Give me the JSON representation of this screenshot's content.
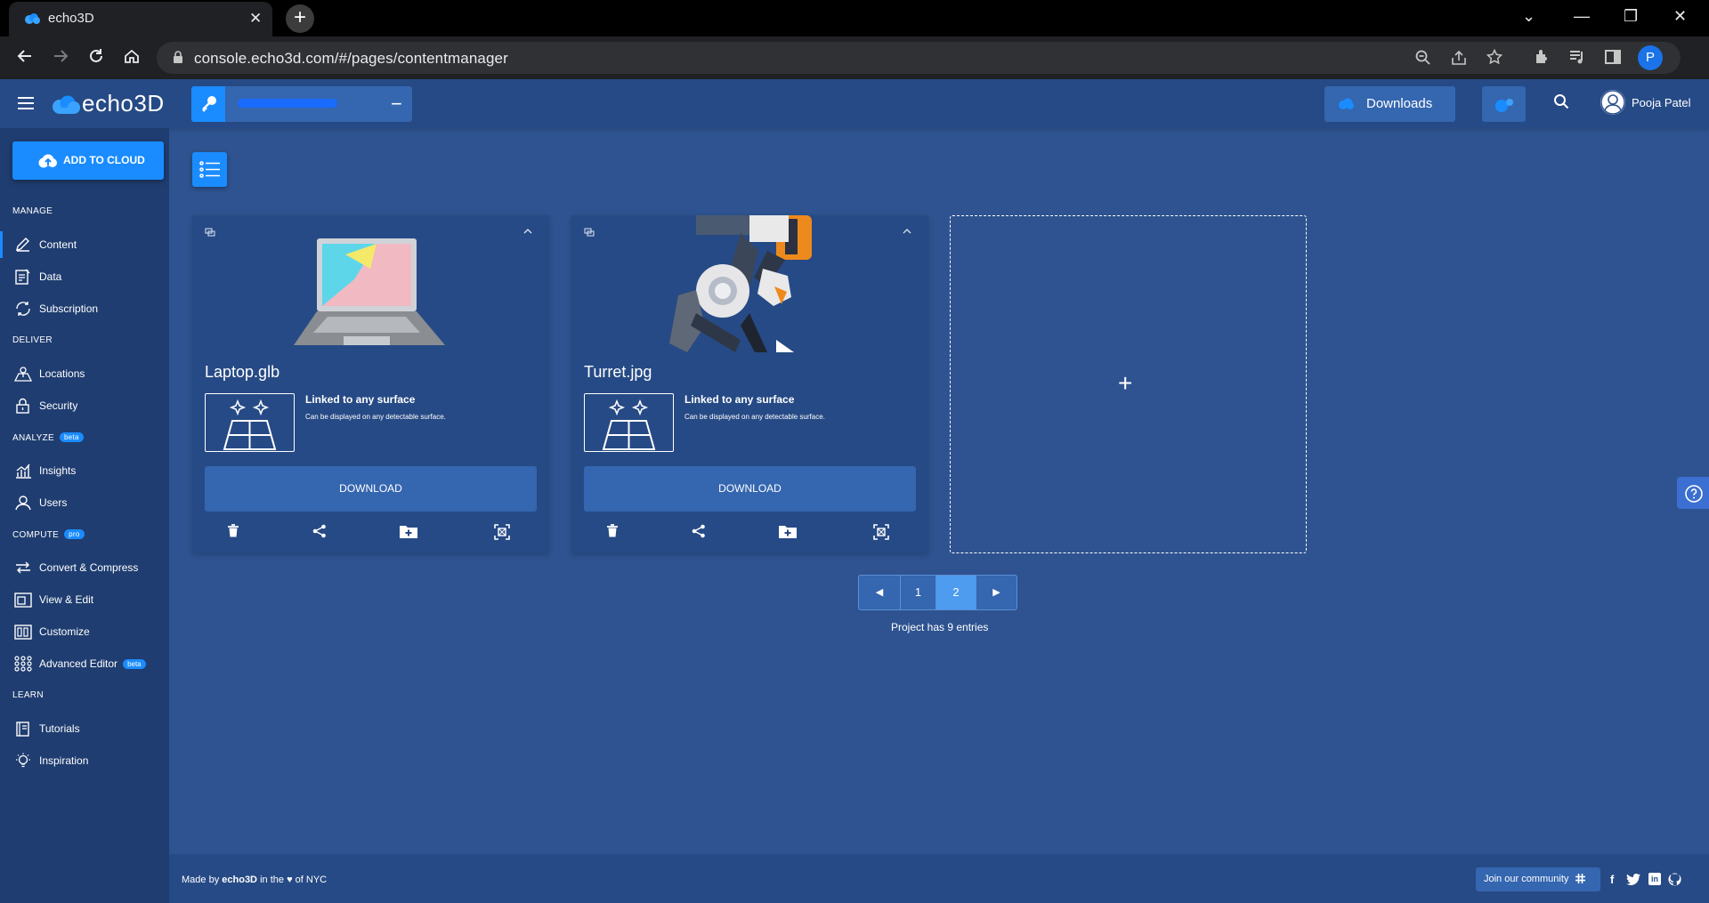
{
  "browser": {
    "tab_title": "echo3D",
    "tab_close": "✕",
    "new_tab": "+",
    "url": "console.echo3d.com/#/pages/contentmanager",
    "profile_initial": "P",
    "window_controls": {
      "dropdown": "⌄",
      "minimize": "—",
      "restore": "❐",
      "close": "✕"
    }
  },
  "header": {
    "logo_text": "echo3D",
    "key_toggle": "−",
    "downloads_label": "Downloads",
    "user_name": "Pooja Patel"
  },
  "sidebar": {
    "add_button": "ADD TO CLOUD",
    "sections": {
      "manage": "MANAGE",
      "deliver": "DELIVER",
      "analyze": "ANALYZE",
      "analyze_badge": "beta",
      "compute": "COMPUTE",
      "compute_badge": "pro",
      "learn": "LEARN"
    },
    "items": {
      "content": "Content",
      "data": "Data",
      "subscription": "Subscription",
      "locations": "Locations",
      "security": "Security",
      "insights": "Insights",
      "users": "Users",
      "convert": "Convert & Compress",
      "view_edit": "View & Edit",
      "customize": "Customize",
      "advanced_editor": "Advanced Editor",
      "advanced_editor_badge": "beta",
      "tutorials": "Tutorials",
      "inspiration": "Inspiration"
    }
  },
  "cards": [
    {
      "name": "Laptop.glb",
      "surface_title": "Linked to any surface",
      "surface_desc": "Can be displayed on any detectable surface.",
      "download_label": "DOWNLOAD"
    },
    {
      "name": "Turret.jpg",
      "surface_title": "Linked to any surface",
      "surface_desc": "Can be displayed on any detectable surface.",
      "download_label": "DOWNLOAD"
    }
  ],
  "add_card": {
    "label": "+"
  },
  "pagination": {
    "prev": "◀",
    "pages": [
      "1",
      "2"
    ],
    "current": "2",
    "next": "▶",
    "entries_text": "Project has 9 entries"
  },
  "footer": {
    "made_by_prefix": "Made by",
    "made_by_brand": "echo3D",
    "made_by_in_the": "in the",
    "heart": "♥",
    "made_by_suffix": "of NYC",
    "community_label": "Join our community",
    "social": {
      "facebook": "f",
      "linkedin": "in"
    }
  },
  "colors": {
    "page_bg": "#2e5390",
    "sidebar_bg": "#1f3d70",
    "accent": "#1a8cff",
    "card_bg": "#264a85",
    "button_bg": "#3566b0"
  }
}
